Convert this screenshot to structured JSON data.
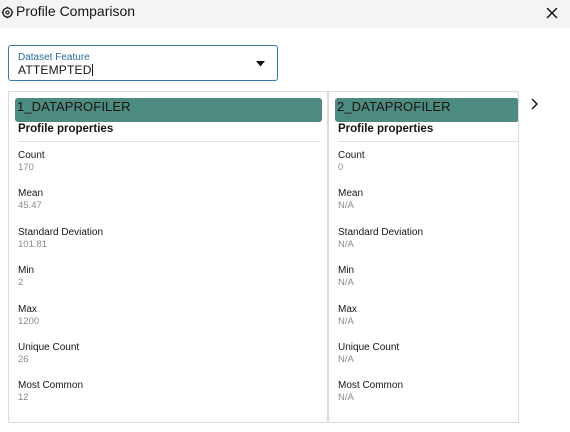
{
  "dialog": {
    "title": "Profile Comparison",
    "icons": {
      "title": "profile-comparison-icon",
      "close": "close-icon",
      "next": "chevron-right-icon"
    }
  },
  "dataset_feature": {
    "label": "Dataset Feature",
    "value": "ATTEMPTED"
  },
  "profiles": [
    {
      "name": "1_DATAPROFILER",
      "section_title": "Profile properties",
      "properties": [
        {
          "label": "Count",
          "value": "170"
        },
        {
          "label": "Mean",
          "value": "45.47"
        },
        {
          "label": "Standard Deviation",
          "value": "101.81"
        },
        {
          "label": "Min",
          "value": "2"
        },
        {
          "label": "Max",
          "value": "1200"
        },
        {
          "label": "Unique Count",
          "value": "26"
        },
        {
          "label": "Most Common",
          "value": "12"
        }
      ]
    },
    {
      "name": "2_DATAPROFILER",
      "section_title": "Profile properties",
      "properties": [
        {
          "label": "Count",
          "value": "0"
        },
        {
          "label": "Mean",
          "value": "N/A"
        },
        {
          "label": "Standard Deviation",
          "value": "N/A"
        },
        {
          "label": "Min",
          "value": "N/A"
        },
        {
          "label": "Max",
          "value": "N/A"
        },
        {
          "label": "Unique Count",
          "value": "N/A"
        },
        {
          "label": "Most Common",
          "value": "N/A"
        }
      ]
    }
  ],
  "colors": {
    "header_fill": "#4d8a7f",
    "field_border": "#3a7ca5",
    "value_text": "#8b8985"
  }
}
